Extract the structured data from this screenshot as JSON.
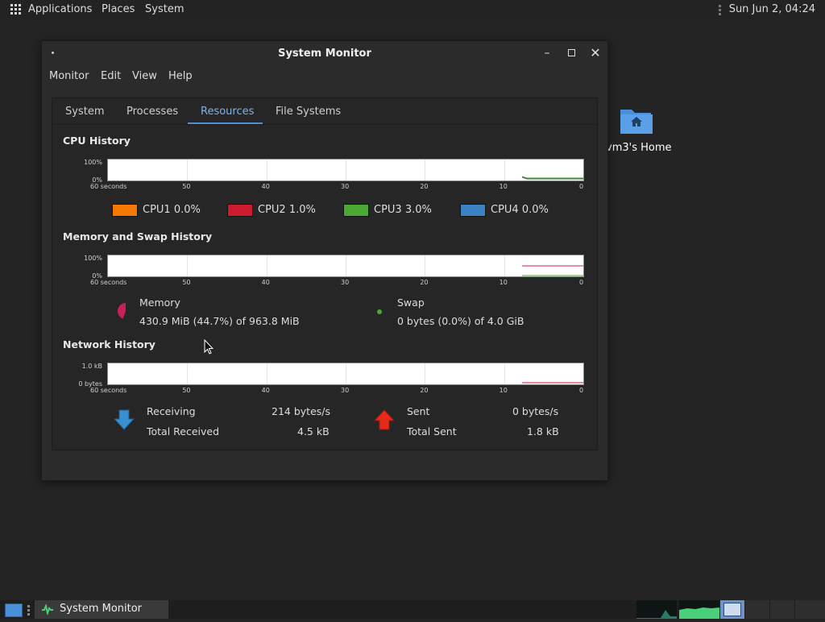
{
  "top_panel": {
    "applications": "Applications",
    "places": "Places",
    "system": "System",
    "clock": "Sun Jun  2, 04:24"
  },
  "desktop": {
    "home_label": "vm3's Home"
  },
  "window": {
    "title": "System Monitor",
    "menu": [
      "Monitor",
      "Edit",
      "View",
      "Help"
    ],
    "tabs": [
      "System",
      "Processes",
      "Resources",
      "File Systems"
    ],
    "active_tab": "Resources"
  },
  "cpu": {
    "section_title": "CPU History",
    "y_top": "100%",
    "y_bottom": "0%",
    "x_ticks": [
      "60 seconds",
      "50",
      "40",
      "30",
      "20",
      "10",
      "0"
    ],
    "legend": [
      {
        "label": "CPU1",
        "value": "0.0%",
        "color": "#f57900"
      },
      {
        "label": "CPU2",
        "value": "1.0%",
        "color": "#cc1a2e"
      },
      {
        "label": "CPU3",
        "value": "3.0%",
        "color": "#4aa832"
      },
      {
        "label": "CPU4",
        "value": "0.0%",
        "color": "#3a82c4"
      }
    ]
  },
  "memory": {
    "section_title": "Memory and Swap History",
    "y_top": "100%",
    "y_bottom": "0%",
    "x_ticks": [
      "60 seconds",
      "50",
      "40",
      "30",
      "20",
      "10",
      "0"
    ],
    "memory_label": "Memory",
    "memory_value": "430.9 MiB (44.7%) of 963.8 MiB",
    "memory_fraction": 0.447,
    "swap_label": "Swap",
    "swap_value": "0 bytes (0.0%) of 4.0 GiB",
    "memory_color": "#c8205c",
    "swap_color": "#4aa832"
  },
  "network": {
    "section_title": "Network History",
    "y_top": "1.0 kB",
    "y_bottom": "0 bytes",
    "x_ticks": [
      "60 seconds",
      "50",
      "40",
      "30",
      "20",
      "10",
      "0"
    ],
    "receiving_label": "Receiving",
    "receiving_value": "214 bytes/s",
    "total_received_label": "Total Received",
    "total_received_value": "4.5 kB",
    "sent_label": "Sent",
    "sent_value": "0 bytes/s",
    "total_sent_label": "Total Sent",
    "total_sent_value": "1.8 kB"
  },
  "taskbar": {
    "task_label": "System Monitor"
  }
}
